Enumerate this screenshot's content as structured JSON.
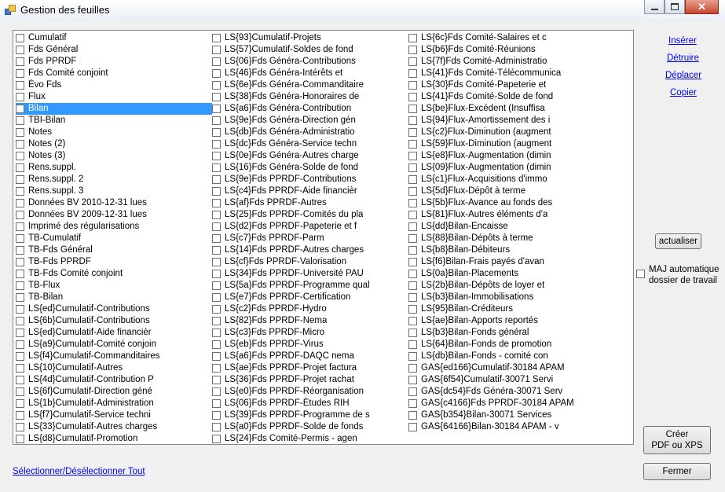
{
  "window": {
    "title": "Gestion des feuilles",
    "close_glyph": "✕"
  },
  "sheets": {
    "col1": [
      "Cumulatif",
      "Fds Général",
      "Fds PPRDF",
      "Fds Comité conjoint",
      "Évo Fds",
      "Flux",
      "Bilan",
      "TBI-Bilan",
      "Notes",
      "Notes (2)",
      "Notes (3)",
      "Rens.suppl.",
      "Rens.suppl. 2",
      "Rens.suppl. 3",
      "Données BV 2010-12-31 lues",
      "Données BV 2009-12-31 lues",
      "Imprimé des régularisations",
      "TB-Cumulatif",
      "TB-Fds Général",
      "TB-Fds PPRDF",
      "TB-Fds Comité conjoint",
      "TB-Flux",
      "TB-Bilan",
      "LS{ed}Cumulatif-Contributions",
      "LS{6b}Cumulatif-Contributions",
      "LS{ed}Cumulatif-Aide financièr",
      "LS{a9}Cumulatif-Comité conjoin",
      "LS{f4}Cumulatif-Commanditaires",
      "LS{10}Cumulatif-Autres",
      "LS{4d}Cumulatif-Contribution P",
      "LS{6f}Cumulatif-Direction géné",
      "LS{1b}Cumulatif-Administration",
      "LS{f7}Cumulatif-Service techni",
      "LS{33}Cumulatif-Autres charges",
      "LS{d8}Cumulatif-Promotion"
    ],
    "col2": [
      "LS{93}Cumulatif-Projets",
      "LS{57}Cumulatif-Soldes de fond",
      "LS{06}Fds Généra-Contributions",
      "LS{46}Fds Généra-Intérêts  et",
      "LS{6e}Fds Généra-Commanditaire",
      "LS{38}Fds Généra-Honoraires de",
      "LS{a6}Fds Généra-Contribution",
      "LS{9e}Fds Généra-Direction gén",
      "LS{db}Fds Généra-Administratio",
      "LS{dc}Fds Généra-Service techn",
      "LS{0e}Fds Généra-Autres charge",
      "LS{16}Fds Généra-Solde de fond",
      "LS{9e}Fds PPRDF-Contributions",
      "LS{c4}Fds PPRDF-Aide financièr",
      "LS{af}Fds PPRDF-Autres",
      "LS{25}Fds PPRDF-Comités du pla",
      "LS{d2}Fds PPRDF-Papeterie et f",
      "LS{c7}Fds PPRDF-Parm",
      "LS{14}Fds PPRDF-Autres charges",
      "LS{cf}Fds PPRDF-Valorisation",
      "LS{34}Fds PPRDF-Université PAU",
      "LS{5a}Fds PPRDF-Programme qual",
      "LS{e7}Fds PPRDF-Certification",
      "LS{c2}Fds PPRDF-Hydro",
      "LS{82}Fds PPRDF-Nema",
      "LS{c3}Fds PPRDF-Micro",
      "LS{eb}Fds PPRDF-Virus",
      "LS{a6}Fds PPRDF-DAQC nema",
      "LS{ae}Fds PPRDF-Projet factura",
      "LS{36}Fds PPRDF-Projet rachat",
      "LS{e0}Fds PPRDF-Réorganisation",
      "LS{06}Fds PPRDF-Études RIH",
      "LS{39}Fds PPRDF-Programme de s",
      "LS{a0}Fds PPRDF-Solde de fonds",
      "LS{24}Fds Comité-Permis - agen"
    ],
    "col3": [
      "LS{6c}Fds Comité-Salaires et c",
      "LS{b6}Fds Comité-Réunions",
      "LS{7f}Fds Comité-Administratio",
      "LS{41}Fds Comité-Télécommunica",
      "LS{30}Fds Comité-Papeterie et",
      "LS{41}Fds Comité-Solde de fond",
      "LS{be}Flux-Excédent (Insuffisa",
      "LS{94}Flux-Amortissement des i",
      "LS{c2}Flux-Diminution (augment",
      "LS{59}Flux-Diminution (augment",
      "LS{e8}Flux-Augmentation (dimin",
      "LS{09}Flux-Augmentation (dimin",
      "LS{c1}Flux-Acquisitions d'immo",
      "LS{5d}Flux-Dépôt à terme",
      "LS{5b}Flux-Avance au fonds des",
      "LS{81}Flux-Autres éléments d'a",
      "LS{dd}Bilan-Encaisse",
      "LS{88}Bilan-Dépôts à terme",
      "LS{b8}Bilan-Débiteurs",
      "LS{f6}Bilan-Frais payés d'avan",
      "LS{0a}Bilan-Placements",
      "LS{2b}Bilan-Dépôts de loyer et",
      "LS{b3}Bilan-Immobilisations",
      "LS{95}Bilan-Créditeurs",
      "LS{ae}Bilan-Apports reportés",
      "LS{b3}Bilan-Fonds général",
      "LS{64}Bilan-Fonds de promotion",
      "LS{db}Bilan-Fonds - comité con",
      "GAS{ed166}Cumulatif-30184 APAM",
      "GAS{6f54}Cumulatif-30071 Servi",
      "GAS{dc54}Fds Généra-30071 Serv",
      "GAS{c4166}Fds PPRDF-30184 APAM",
      "GAS{b354}Bilan-30071 Services",
      "GAS{64166}Bilan-30184 APAM - v"
    ],
    "selected": "Bilan"
  },
  "actions": {
    "inserer": "Insérer",
    "detruire": "Détruire",
    "deplacer": "Déplacer",
    "copier": "Copier",
    "actualiser": "actualiser",
    "maj_line1": "MAJ  automatique",
    "maj_line2": "dossier de travail",
    "creer_line1": "Créer",
    "creer_line2": "PDF ou XPS",
    "fermer": "Fermer",
    "select_all": "Sélectionner/Désélectionner Tout"
  }
}
